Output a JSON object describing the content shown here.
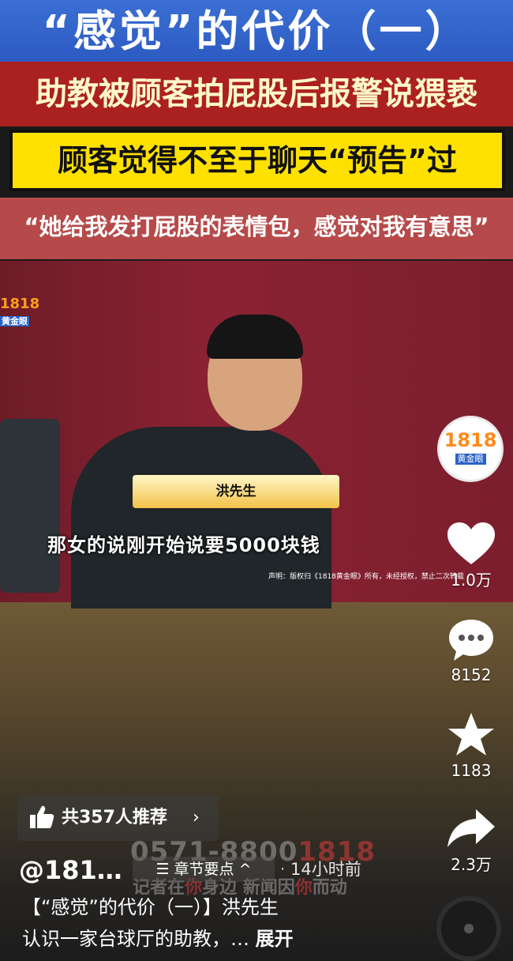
{
  "header": {
    "title": "“感觉”的代价（一）",
    "headline": "助教被顾客拍屁股后报警说猥亵",
    "subheadline": "顾客觉得不至于聊天“预告”过",
    "quote": "“她给我发打屁股的表情包，感觉对我有意思”"
  },
  "video": {
    "channel_logo_number": "1818",
    "channel_logo_text": "黄金眼",
    "name_plate": "洪先生",
    "subtitle": "那女的说刚开始说要5000块钱",
    "disclaimer": "声明：版权归《1818黄金眼》所有，未经授权，禁止二次转载"
  },
  "sidebar": {
    "avatar_number": "1818",
    "avatar_text": "黄金眼",
    "like_count": "1.0万",
    "comment_count": "8152",
    "favorite_count": "1183",
    "share_count": "2.3万"
  },
  "bottom": {
    "recommend_label": "共357人推荐",
    "recommend_chevron": "›",
    "author": "@181…",
    "chapter_label": "☰ 章节要点 ^",
    "dot": "·",
    "time": "14小时前",
    "watermark_phone_a": "0571-8800",
    "watermark_phone_b": "1818",
    "watermark_slogan_a": "记者在",
    "watermark_slogan_b": "你",
    "watermark_slogan_c": "身边 新闻因",
    "watermark_slogan_d": "你",
    "watermark_slogan_e": "而动",
    "description_line1": "【“感觉”的代价（一）】洪先生",
    "description_line2": "认识一家台球厅的助教，…",
    "expand_label": "展开"
  },
  "colors": {
    "banner_blue": "#3b6fd4",
    "banner_red": "#ab2020",
    "banner_yellow": "#ffe100",
    "video_bg": "#8a2233"
  }
}
